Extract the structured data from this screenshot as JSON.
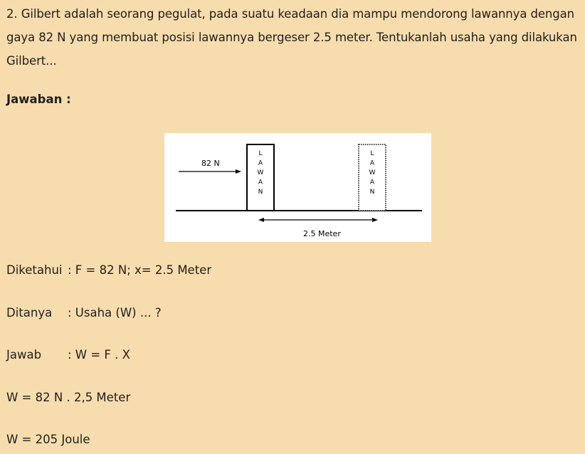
{
  "question": "2. Gilbert adalah seorang pegulat, pada suatu keadaan dia mampu mendorong lawannya dengan gaya 82 N yang membuat posisi lawannya bergeser 2.5 meter. Tentukanlah usaha yang dilakukan Gilbert...",
  "answer_heading": "Jawaban :",
  "figure": {
    "force_label": "82 N",
    "box_letters": [
      "L",
      "A",
      "W",
      "A",
      "N"
    ],
    "distance_label": "2.5 Meter"
  },
  "known": {
    "label": "Diketahui",
    "value": ": F = 82 N; x= 2.5 Meter"
  },
  "asked": {
    "label": "Ditanya",
    "value": ": Usaha (W) ... ?"
  },
  "answer": {
    "label": "Jawab",
    "value": ": W = F . X"
  },
  "step1": "W = 82 N . 2,5 Meter",
  "step2": "W = 205 Joule"
}
